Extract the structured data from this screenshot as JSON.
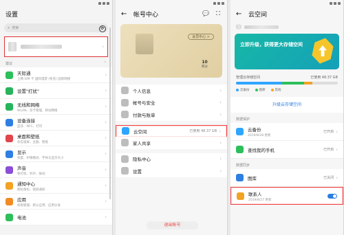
{
  "panel1": {
    "title": "设置",
    "search_placeholder": "搜索",
    "section_label": "建议",
    "items": [
      {
        "title": "天际通",
        "sub": "上网 SIM 卡 国际漫游 (免充) 国际网络",
        "color": "#2cbf5a",
        "icon": "globe-icon"
      },
      {
        "title": "设置\"打扰\"",
        "sub": "",
        "color": "#28b45b",
        "icon": "phone-icon"
      },
      {
        "title": "无线和网络",
        "sub": "WLAN、双卡管理、移动网络",
        "color": "#27b55c",
        "icon": "wifi-icon"
      },
      {
        "title": "设备连接",
        "sub": "蓝牙、NFC、打印",
        "color": "#2f7fe2",
        "icon": "device-icon"
      },
      {
        "title": "桌面和壁纸",
        "sub": "杂志锁屏、主题、壁纸",
        "color": "#e0464c",
        "icon": "desktop-icon"
      },
      {
        "title": "显示",
        "sub": "亮度、护眼模式、字体与显示大小",
        "color": "#2f7fe2",
        "icon": "display-icon"
      },
      {
        "title": "声音",
        "sub": "免打扰、铃声、振动",
        "color": "#8a4ed8",
        "icon": "sound-icon"
      },
      {
        "title": "通知中心",
        "sub": "图标角标、锁屏通知",
        "color": "#f2a324",
        "icon": "notification-icon"
      },
      {
        "title": "应用",
        "sub": "权限管理、默认应用、应用分身",
        "color": "#f28b22",
        "icon": "apps-icon"
      },
      {
        "title": "电池",
        "sub": "",
        "color": "#2cbf5a",
        "icon": "battery-icon"
      }
    ]
  },
  "panel2": {
    "title": "帐号中心",
    "level_label": "会员中心 >",
    "points_value": "10",
    "items": [
      {
        "title": "个人信息",
        "value": "",
        "icon": "person-icon"
      },
      {
        "title": "帐号与安全",
        "value": "",
        "icon": "shield-icon"
      },
      {
        "title": "付款与账单",
        "value": "",
        "icon": "payment-icon"
      },
      {
        "title": "云空间",
        "value": "已使用 48.37 GB",
        "icon": "cloud-icon"
      },
      {
        "title": "家人共享",
        "value": "",
        "icon": "family-icon"
      },
      {
        "title": "隐私中心",
        "value": "",
        "icon": "privacy-icon"
      },
      {
        "title": "设置",
        "value": "",
        "icon": "settings-icon"
      }
    ],
    "logout": "退出帐号"
  },
  "panel3": {
    "title": "云空间",
    "banner_title": "立即升级，获得更大存储空间",
    "banner_sub": "",
    "storage_label": "管理云存储空间",
    "storage_used": "已使用 48.37 GB",
    "legend": [
      "云备份",
      "图库",
      "其他"
    ],
    "legend_colors": [
      "#2fa5ff",
      "#2cbf5a",
      "#f2a324"
    ],
    "upgrade": "升级云存储空间",
    "sec_protect": "数据保护",
    "sec_sync": "数据同步",
    "items": [
      {
        "title": "云备份",
        "sub": "2019/8/28 更新",
        "stat": "已开启",
        "icon": "backup-icon",
        "color": "#2fa5ff"
      },
      {
        "title": "查找我的手机",
        "sub": "",
        "stat": "已开启",
        "icon": "find-phone-icon",
        "color": "#2cbf5a"
      },
      {
        "title": "图库",
        "sub": "",
        "stat": "已关闭",
        "icon": "gallery-icon",
        "color": "#2f7fe2"
      },
      {
        "title": "联系人",
        "sub": "2019/8/27 更新",
        "stat": "",
        "icon": "contacts-icon",
        "color": "#f2a324"
      }
    ]
  }
}
